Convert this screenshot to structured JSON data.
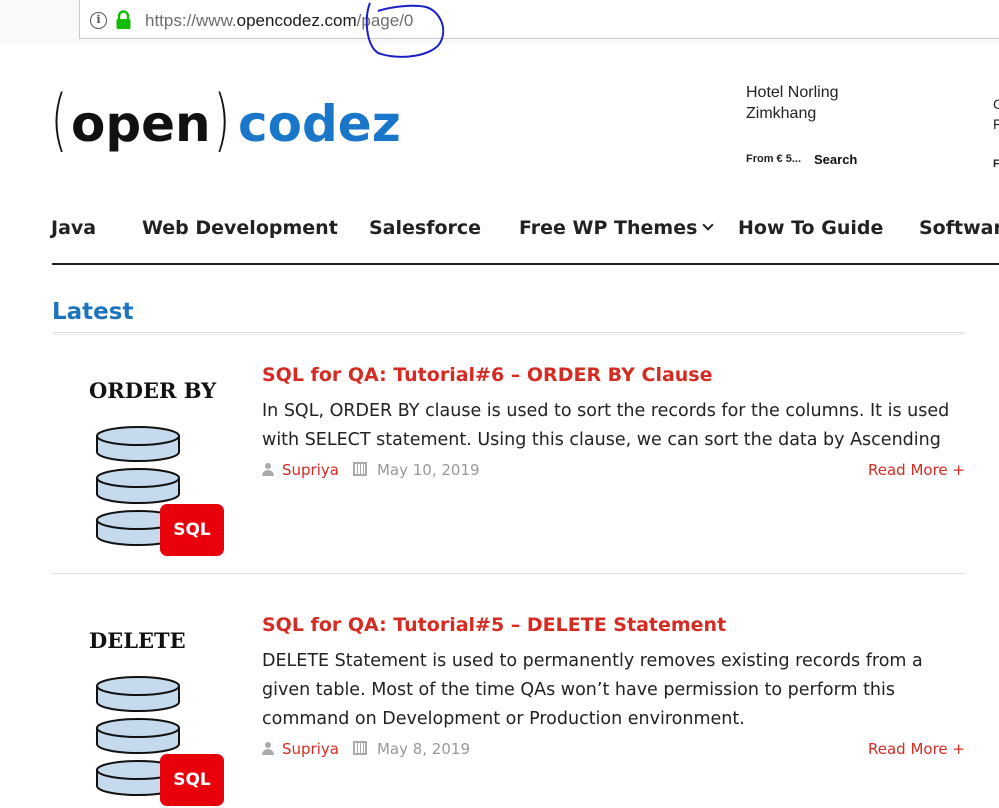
{
  "browser": {
    "url_base": "https://www.",
    "url_domain": "opencodez.com",
    "url_path": "/page/0"
  },
  "header": {
    "logo_left_bracket": "(",
    "logo_word1": "open",
    "logo_right_bracket": ")",
    "logo_word2": "codez",
    "ad_line1": "Hotel Norling",
    "ad_line2": "Zimkhang",
    "ad_price": "From € 5...",
    "ad_search": "Search"
  },
  "nav": {
    "items": [
      "Java",
      "Web Development",
      "Salesforce",
      "Free WP Themes",
      "How To Guide",
      "Software"
    ]
  },
  "main": {
    "section_title": "Latest",
    "posts": [
      {
        "thumb_caption": "ORDER BY",
        "thumb_badge": "SQL",
        "title": "SQL for QA: Tutorial#6 – ORDER BY Clause",
        "excerpt": "In SQL, ORDER BY clause is used to sort the records for the columns. It is used with SELECT statement. Using this clause, we can sort the data by Ascending",
        "author": "Supriya",
        "date": "May 10, 2019",
        "read_more": "Read More +"
      },
      {
        "thumb_caption": "DELETE",
        "thumb_badge": "SQL",
        "title": "SQL for QA: Tutorial#5 – DELETE Statement",
        "excerpt": "DELETE Statement is used to permanently removes existing records from a given table. Most of the time QAs won’t have permission to perform this command on Development or Production environment.",
        "author": "Supriya",
        "date": "May 8, 2019",
        "read_more": "Read More +"
      }
    ]
  },
  "colors": {
    "brand_blue": "#1976c8",
    "title_red": "#d62b22",
    "badge_red": "#e8000b"
  }
}
